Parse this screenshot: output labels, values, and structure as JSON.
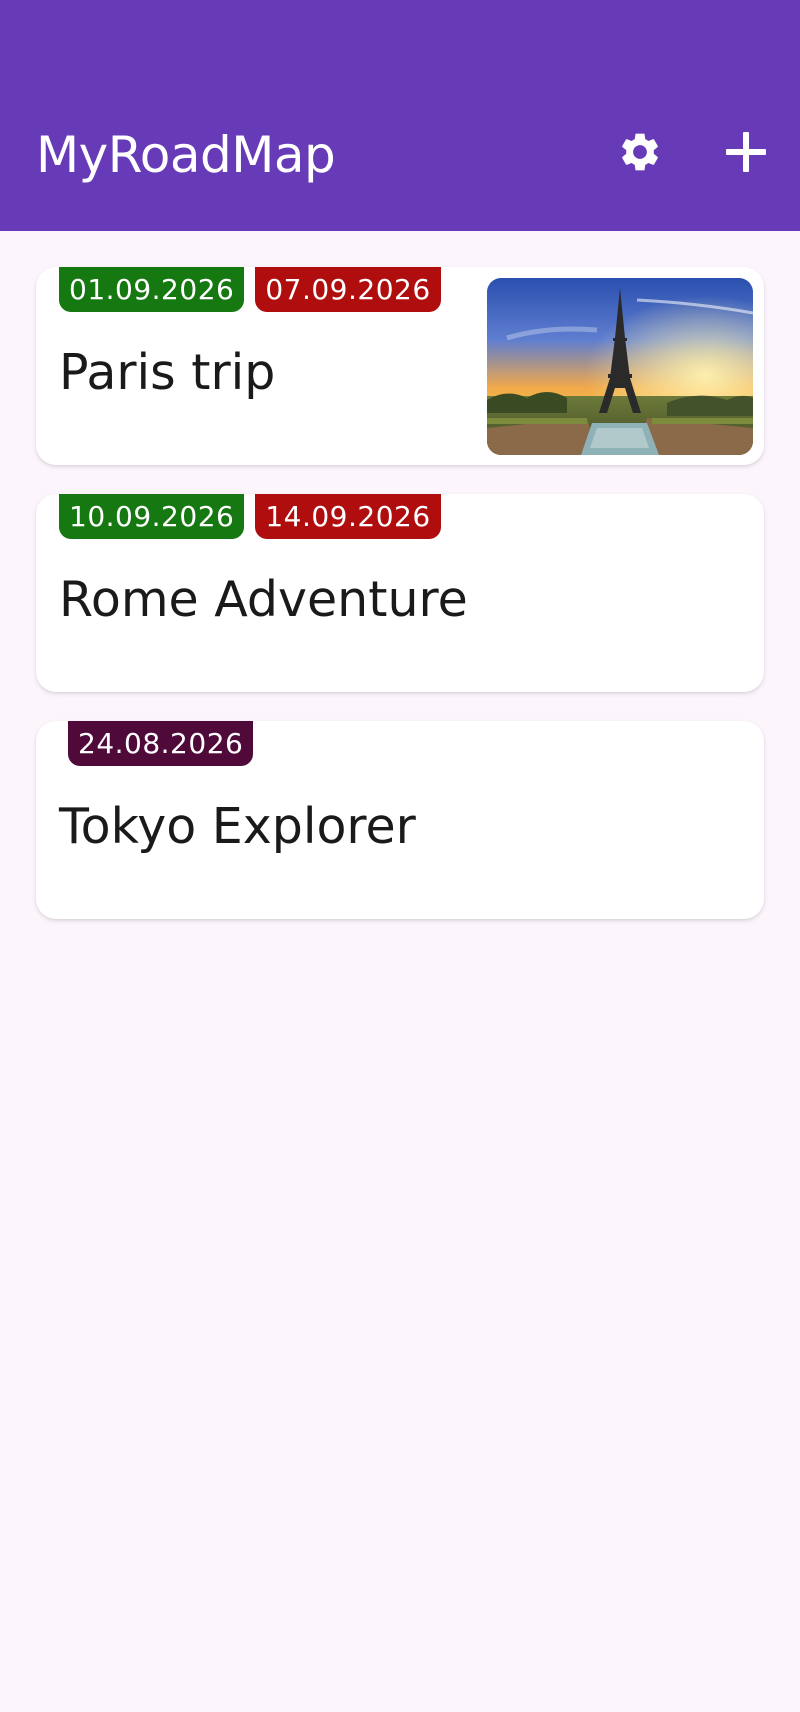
{
  "app": {
    "title": "MyRoadMap",
    "settings_icon": "gear-icon",
    "add_icon": "plus-icon",
    "colors": {
      "app_bar": "#673ab7",
      "background": "#fcf5fc",
      "start_date_badge": "#167811",
      "end_date_badge": "#b00e0e",
      "single_date_badge": "#4f0a3a"
    }
  },
  "trips": [
    {
      "name": "Paris trip",
      "start_date": "01.09.2026",
      "end_date": "07.09.2026",
      "has_image": true
    },
    {
      "name": "Rome Adventure",
      "start_date": "10.09.2026",
      "end_date": "14.09.2026",
      "has_image": false
    },
    {
      "name": "Tokyo Explorer",
      "date": "24.08.2026",
      "has_image": false
    }
  ]
}
